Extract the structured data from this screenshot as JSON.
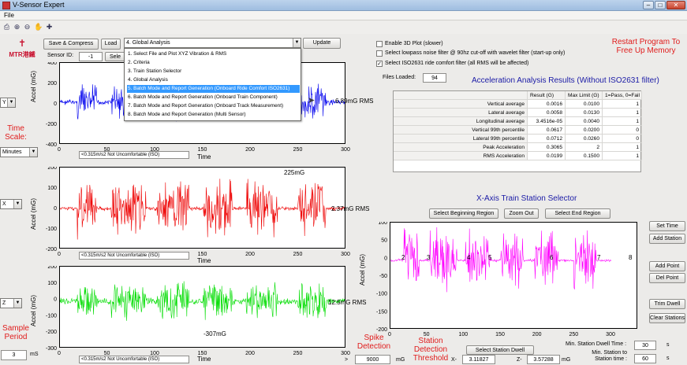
{
  "window": {
    "title": "V-Sensor Expert",
    "menu_file": "File"
  },
  "colors": {
    "blue_trace": "#0000ee",
    "red_trace": "#ee0000",
    "green_trace": "#00dd00",
    "magenta_trace": "#ff00ff",
    "accent_red": "#e01c1c",
    "select_blue": "#3399ff"
  },
  "logo": {
    "text": "MTR港鐵"
  },
  "toolbar": {
    "icons": [
      "print-icon",
      "zoom-in-icon",
      "zoom-out-icon",
      "pan-icon",
      "data-cursor-icon"
    ]
  },
  "controls": {
    "save_compress": "Save & Compress",
    "load": "Load",
    "sensor_id_label": "Sensor ID:",
    "sensor_id_value": "-1",
    "select_partial": "Sele",
    "analysis_selected": "4. Global Analysis",
    "update": "Update"
  },
  "analysis_options": [
    "1. Select File and Plot XYZ Vibration & RMS",
    "2. Criteria",
    "3. Train Station Selector",
    "4. Global Analysis",
    "5. Batch Mode and Report Generation (Onboard Ride Comfort ISO2631)",
    "6. Batch Mode and Report Generation (Onboard Train Component)",
    "7. Batch Mode and Report Generation (Onboard Track Measurement)",
    "8. Batch Mode and Report Generation (Multi Sensor)"
  ],
  "analysis_highlighted_index": 4,
  "left_panel": {
    "axis_y": "Y",
    "time_scale_label": "Time Scale:",
    "time_scale_value": "Minutes",
    "axis_x": "X",
    "axis_z": "Z",
    "sample_period_label": "Sample Period",
    "sample_period_value": "3",
    "sample_period_unit": "mS"
  },
  "plots": {
    "y_label": "Accel (mG)",
    "x_label": "Time",
    "x_ticks": [
      "0",
      "50",
      "100",
      "150",
      "200",
      "250",
      "300"
    ],
    "y_ticks": [
      "400",
      "200",
      "0",
      "-200",
      "-400"
    ],
    "y_ticks_red": [
      "200",
      "100",
      "0",
      "-100",
      "-200"
    ],
    "y_ticks_green": [
      "200",
      "100",
      "0",
      "-100",
      "-200",
      "-300"
    ],
    "blue_rms": "6.89mG RMS",
    "red_rms": "2.37mG RMS",
    "green_rms": "12.5mG RMS",
    "red_peak": "225mG",
    "green_peak": "-307mG",
    "comfort_1": "<0.315m/s2 Not Uncomfortable (ISO)",
    "comfort_2": "<0.315m/s2 Not Uncomfortable (ISO)",
    "comfort_3": "<0.315m/s2 Not Uncomfortable (ISO)"
  },
  "options": {
    "enable_3d": "Enable 3D Plot (slower)",
    "lowpass": "Select lowpass noise filter @ 90hz cut-off with wavelet filter (start-up only)",
    "iso_filter": "Select ISO2631 ride comfort filter (all RMS will be affected)",
    "iso_checked": true,
    "files_loaded_label": "Files Loaded:",
    "files_loaded_value": "94",
    "restart_note": "Restart Program To Free Up Memory"
  },
  "results": {
    "title": "Acceleration Analysis Results (Without ISO2631 filter)",
    "columns": [
      "Result (G)",
      "Max Limit (G)",
      "1=Pass, 0=Fail"
    ],
    "rows": [
      {
        "name": "Vertical average",
        "result": "0.0016",
        "limit": "0.0100",
        "pass": "1"
      },
      {
        "name": "Lateral average",
        "result": "0.0058",
        "limit": "0.0130",
        "pass": "1"
      },
      {
        "name": "Longitudinal average",
        "result": "3.4516e-05",
        "limit": "0.0040",
        "pass": "1"
      },
      {
        "name": "Vertical 99th percentile",
        "result": "0.0617",
        "limit": "0.0200",
        "pass": "0"
      },
      {
        "name": "Lateral 99th percentile",
        "result": "0.0712",
        "limit": "0.0260",
        "pass": "0"
      },
      {
        "name": "Peak Acceleration",
        "result": "0.3065",
        "limit": "2",
        "pass": "1"
      },
      {
        "name": "RMS Acceleration",
        "result": "0.0199",
        "limit": "0.1500",
        "pass": "1"
      }
    ]
  },
  "station_selector": {
    "title": "X-Axis Train Station Selector",
    "select_begin": "Select Beginning Region",
    "zoom_out": "Zoom Out",
    "select_end": "Select End Region",
    "set_time": "Set Time",
    "add_station": "Add Station",
    "add_point": "Add Point",
    "del_point": "Del Point",
    "trim_dwell": "Trim Dwell",
    "clear_stations": "Clear Stations",
    "y_label": "Accel (mG)",
    "x_ticks": [
      "0",
      "50",
      "100",
      "150",
      "200",
      "250",
      "300"
    ],
    "y_ticks": [
      "100",
      "50",
      "0",
      "-50",
      "-100",
      "-150",
      "-200"
    ],
    "station_markers": [
      "2",
      "3",
      "4",
      "5",
      "6",
      "7",
      "8"
    ],
    "spike_label": "Spike Detection",
    "station_threshold_label": "Station Detection Threshold",
    "select_station_dwell": "Select Station Dwell",
    "min_dwell_label": "Min. Station Dwell Time :",
    "min_dwell_value": "30",
    "min_dwell_unit": "s",
    "min_station_label": "Min. Station to Station time :",
    "min_station_value": "60",
    "min_station_unit": "s",
    "gt_symbol": ">",
    "spike_value": "9000",
    "spike_unit": "mG",
    "x_label": "X-",
    "x_value": "3.11827",
    "z_label": "Z-",
    "z_value": "3.57288",
    "threshold_unit": "mG"
  }
}
